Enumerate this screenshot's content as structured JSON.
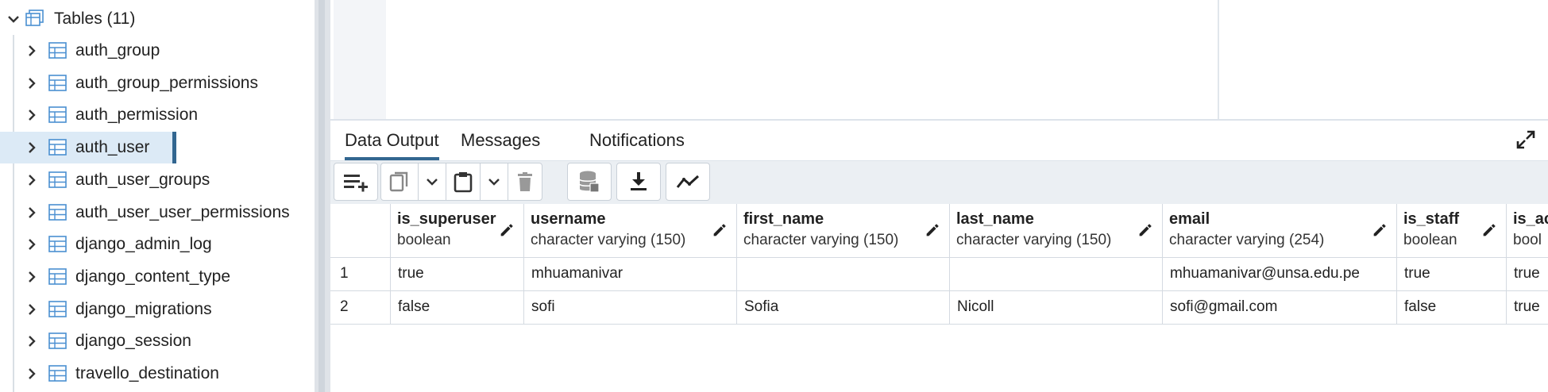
{
  "tree": {
    "header_label": "Tables (11)",
    "items": [
      {
        "label": "auth_group"
      },
      {
        "label": "auth_group_permissions"
      },
      {
        "label": "auth_permission"
      },
      {
        "label": "auth_user",
        "selected": true
      },
      {
        "label": "auth_user_groups"
      },
      {
        "label": "auth_user_user_permissions"
      },
      {
        "label": "django_admin_log"
      },
      {
        "label": "django_content_type"
      },
      {
        "label": "django_migrations"
      },
      {
        "label": "django_session"
      },
      {
        "label": "travello_destination"
      }
    ]
  },
  "tabs": [
    "Data Output",
    "Messages",
    "Notifications"
  ],
  "toolbar": {
    "buttons": [
      "add-row-icon",
      "copy-icon",
      "chevron-down-icon",
      "paste-icon",
      "chevron-down-icon",
      "trash-icon",
      "save-data-icon",
      "download-icon",
      "graph-icon"
    ]
  },
  "grid": {
    "columns": [
      {
        "name": "is_superuser",
        "type": "boolean"
      },
      {
        "name": "username",
        "type": "character varying (150)"
      },
      {
        "name": "first_name",
        "type": "character varying (150)"
      },
      {
        "name": "last_name",
        "type": "character varying (150)"
      },
      {
        "name": "email",
        "type": "character varying (254)"
      },
      {
        "name": "is_staff",
        "type": "boolean"
      },
      {
        "name": "is_ac",
        "type": "bool"
      }
    ],
    "rows": [
      {
        "num": "1",
        "cells": [
          "true",
          "mhuamanivar",
          "",
          "",
          "mhuamanivar@unsa.edu.pe",
          "true",
          "true"
        ]
      },
      {
        "num": "2",
        "cells": [
          "false",
          "sofi",
          "Sofia",
          "Nicoll",
          "sofi@gmail.com",
          "false",
          "true"
        ]
      }
    ]
  },
  "colors": {
    "accent": "#326690",
    "selected_bg": "#dceaf6",
    "icon_blue": "#4a8fd1"
  }
}
